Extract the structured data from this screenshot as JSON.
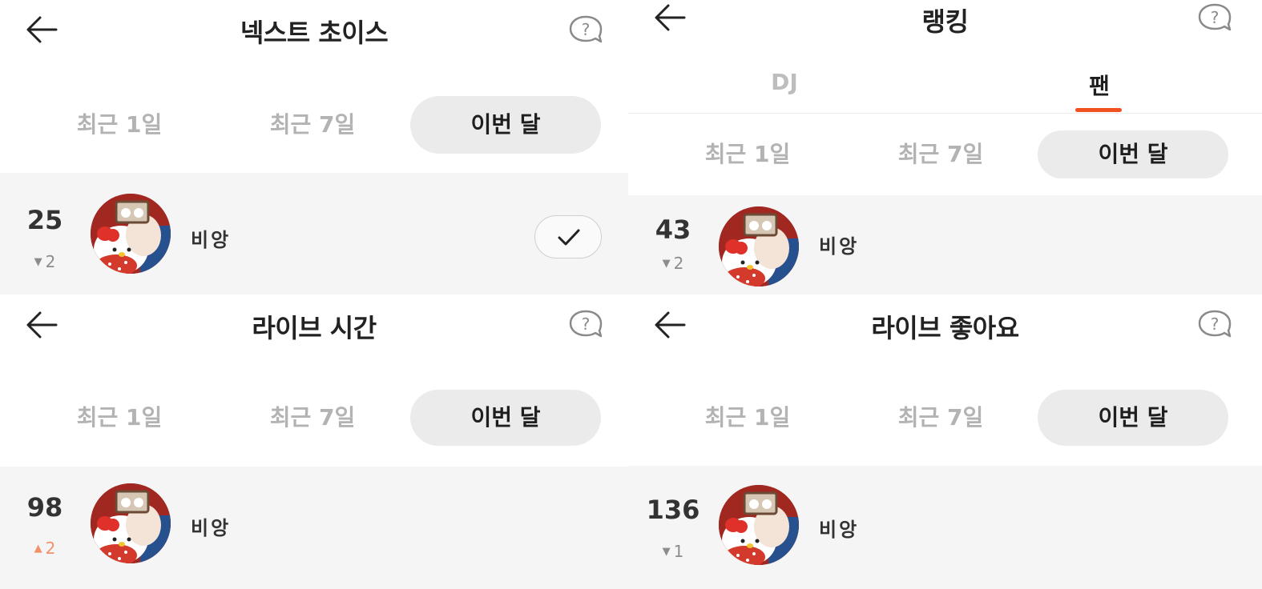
{
  "colors": {
    "accent": "#f0511e",
    "active_chip_bg": "#ebebeb",
    "row_bg": "#f5f5f5",
    "inactive_text": "#b3b3b3",
    "up_color": "#f2906a"
  },
  "icons": {
    "back": "back-arrow-icon",
    "help": "help-speech-bubble-icon",
    "check": "check-icon",
    "avatar": "hello-kitty-avatar"
  },
  "screens": [
    {
      "title": "넥스트 초이스",
      "filters": [
        "최근 1일",
        "최근 7일",
        "이번 달"
      ],
      "selected_filter": "이번 달",
      "entry": {
        "rank": "25",
        "change": "2",
        "direction": "down",
        "name": "비앙",
        "has_check_button": true
      }
    },
    {
      "title": "랭킹",
      "tabs": [
        "DJ",
        "팬"
      ],
      "active_tab": "팬",
      "filters": [
        "최근 1일",
        "최근 7일",
        "이번 달"
      ],
      "selected_filter": "이번 달",
      "entry": {
        "rank": "43",
        "change": "2",
        "direction": "down",
        "name": "비앙"
      }
    },
    {
      "title": "라이브 시간",
      "filters": [
        "최근 1일",
        "최근 7일",
        "이번 달"
      ],
      "selected_filter": "이번 달",
      "entry": {
        "rank": "98",
        "change": "2",
        "direction": "up",
        "name": "비앙"
      }
    },
    {
      "title": "라이브 좋아요",
      "filters": [
        "최근 1일",
        "최근 7일",
        "이번 달"
      ],
      "selected_filter": "이번 달",
      "entry": {
        "rank": "136",
        "change": "1",
        "direction": "down",
        "name": "비앙"
      }
    }
  ]
}
